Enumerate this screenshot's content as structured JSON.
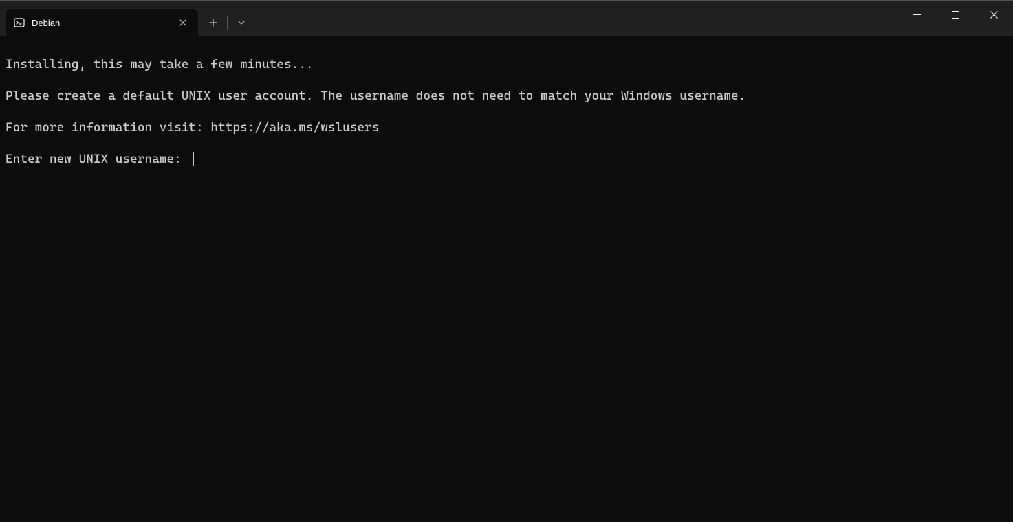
{
  "titlebar": {
    "tab": {
      "title": "Debian",
      "icon": "terminal-icon"
    }
  },
  "terminal": {
    "lines": {
      "l0": "Installing, this may take a few minutes...",
      "l1": "Please create a default UNIX user account. The username does not need to match your Windows username.",
      "l2": "For more information visit: https://aka.ms/wslusers",
      "l3": "Enter new UNIX username: "
    }
  }
}
